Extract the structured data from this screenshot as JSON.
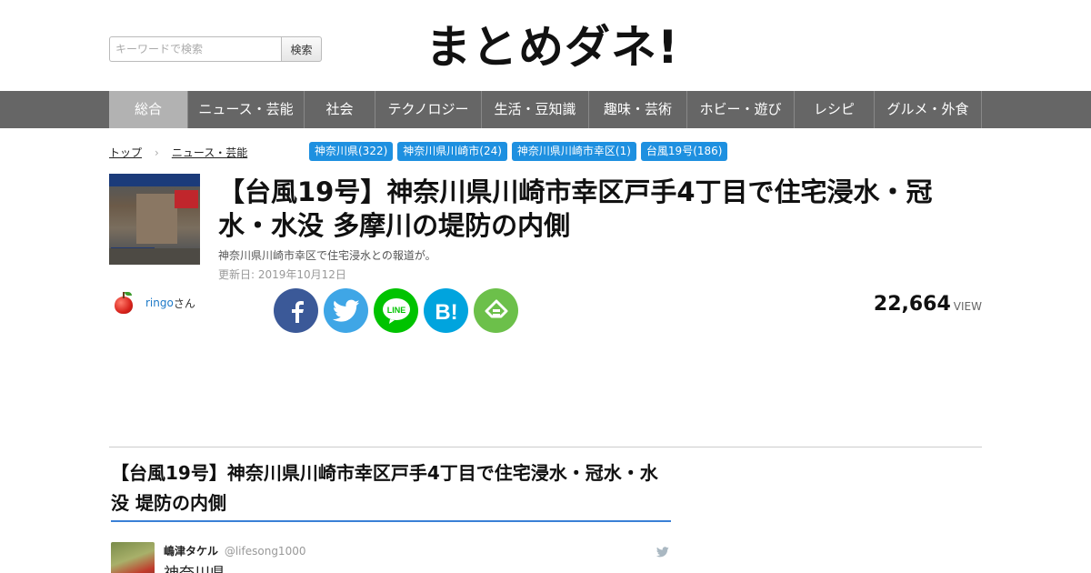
{
  "header": {
    "search_placeholder": "キーワードで検索",
    "search_button": "検索",
    "logo": "まとめダネ!"
  },
  "nav": {
    "items": [
      {
        "label": "総合",
        "active": true
      },
      {
        "label": "ニュース・芸能",
        "active": false
      },
      {
        "label": "社会",
        "active": false
      },
      {
        "label": "テクノロジー",
        "active": false
      },
      {
        "label": "生活・豆知識",
        "active": false
      },
      {
        "label": "趣味・芸術",
        "active": false
      },
      {
        "label": "ホビー・遊び",
        "active": false
      },
      {
        "label": "レシピ",
        "active": false
      },
      {
        "label": "グルメ・外食",
        "active": false
      }
    ]
  },
  "breadcrumb": {
    "items": [
      "トップ",
      "ニュース・芸能"
    ],
    "separator": "›"
  },
  "tags": [
    "神奈川県(322)",
    "神奈川県川崎市(24)",
    "神奈川県川崎市幸区(1)",
    "台風19号(186)"
  ],
  "article": {
    "title": "【台風19号】神奈川県川崎市幸区戸手4丁目で住宅浸水・冠水・水没 多摩川の堤防の内側",
    "description": "神奈川県川崎市幸区で住宅浸水との報道が。",
    "updated": "更新日: 2019年10月12日",
    "author_name": "ringo",
    "author_suffix": "さん",
    "views": "22,664",
    "views_unit": "VIEW"
  },
  "share_buttons": [
    {
      "name": "facebook-share-button",
      "icon": "facebook-icon",
      "glyph": "f"
    },
    {
      "name": "twitter-share-button",
      "icon": "twitter-icon",
      "glyph": ""
    },
    {
      "name": "line-share-button",
      "icon": "line-icon",
      "glyph": "LINE"
    },
    {
      "name": "hatena-share-button",
      "icon": "hatena-bookmark-icon",
      "glyph": "B!"
    },
    {
      "name": "feedly-share-button",
      "icon": "feedly-icon",
      "glyph": ""
    }
  ],
  "section": {
    "heading": "【台風19号】神奈川県川崎市幸区戸手4丁目で住宅浸水・冠水・水没 堤防の内側"
  },
  "tweet": {
    "display_name": "嶋津タケル",
    "handle": "@lifesong1000",
    "text": "神奈川県"
  },
  "colors": {
    "nav_bg": "#666666",
    "nav_active": "#b2b2b2",
    "tag_bg": "#1e90e0",
    "link": "#1e7ac8",
    "heading_underline": "#3a80d6",
    "facebook": "#3b5998",
    "twitter": "#3fa6e6",
    "line": "#00c300",
    "hatena": "#00a4de",
    "feedly": "#6cc04a"
  }
}
